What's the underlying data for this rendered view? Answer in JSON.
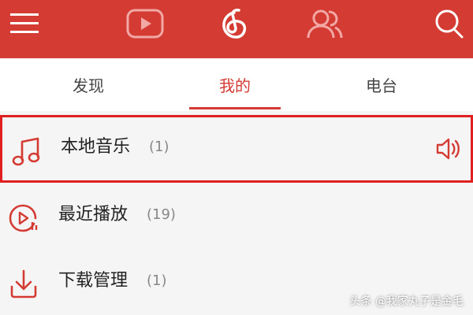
{
  "topbar": {
    "background": "#d43c33",
    "icons": [
      "menu-icon",
      "video-icon",
      "music-logo-icon",
      "friends-icon",
      "search-icon"
    ]
  },
  "tabs": [
    {
      "label": "发现",
      "active": false
    },
    {
      "label": "我的",
      "active": true
    },
    {
      "label": "电台",
      "active": false
    }
  ],
  "list": [
    {
      "label": "本地音乐",
      "count": "(1)",
      "icon": "music-note-icon",
      "playing": true,
      "highlighted": true
    },
    {
      "label": "最近播放",
      "count": "(19)",
      "icon": "recent-play-icon",
      "playing": false,
      "highlighted": false
    },
    {
      "label": "下载管理",
      "count": "(1)",
      "icon": "download-icon",
      "playing": false,
      "highlighted": false
    }
  ],
  "watermark": "头条 @我家丸子是金毛",
  "accent_color": "#d43c33"
}
